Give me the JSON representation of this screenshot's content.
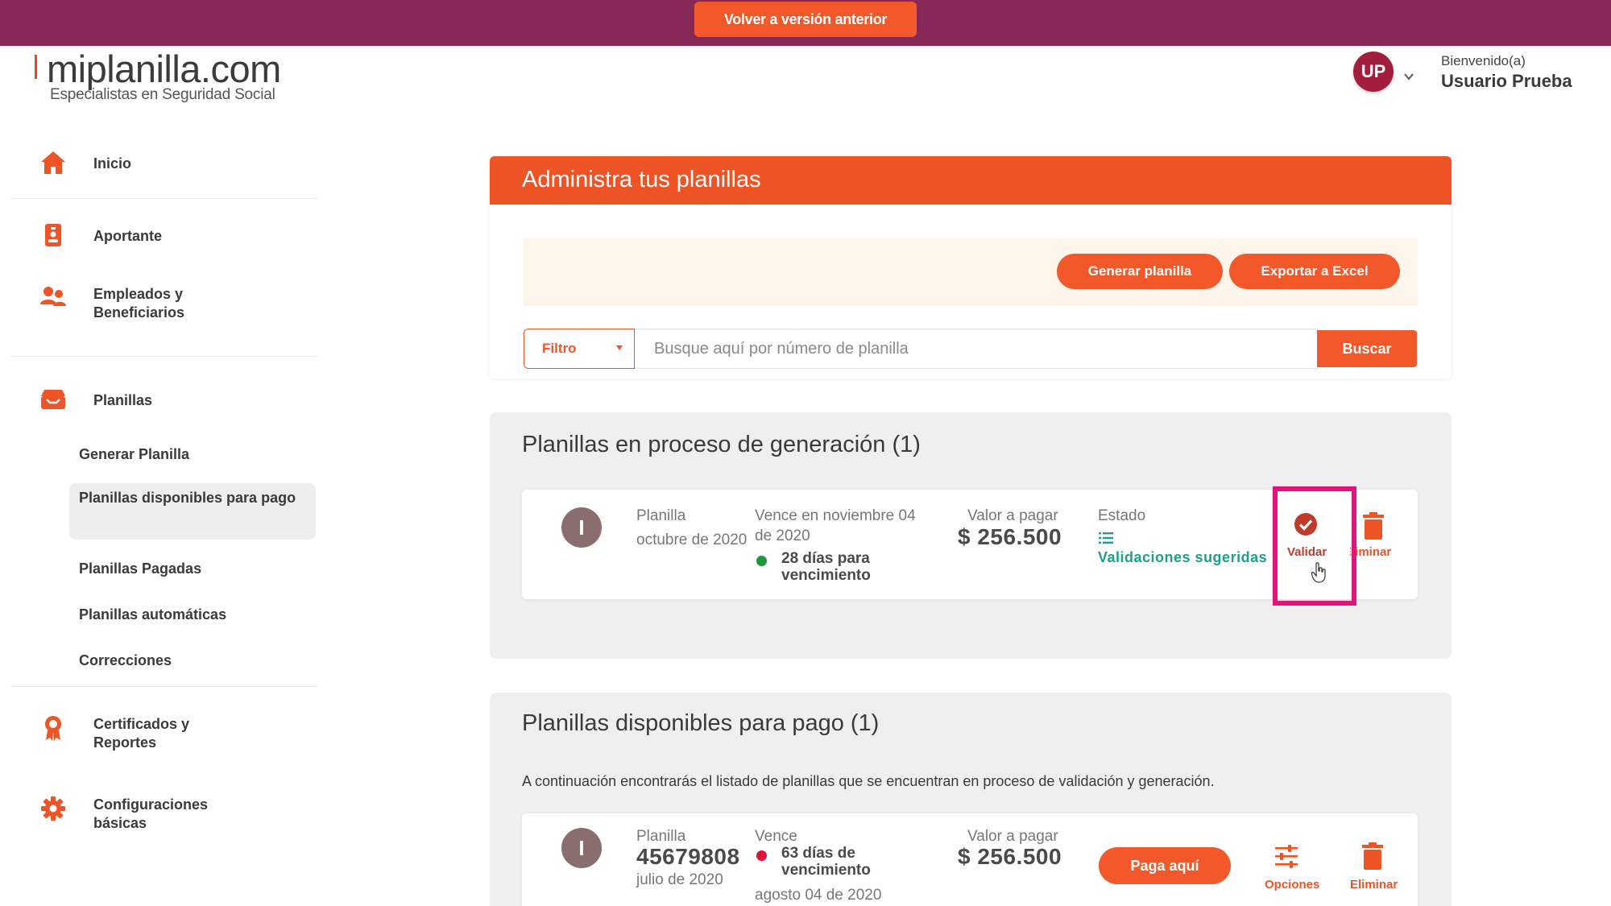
{
  "banner": {
    "back_label": "Volver a versión anterior"
  },
  "logo": {
    "name": "miplanilla.com",
    "tagline": "Especialistas en Seguridad Social"
  },
  "user": {
    "initials": "UP",
    "greeting": "Bienvenido(a)",
    "name": "Usuario Prueba"
  },
  "sidebar": {
    "items": [
      {
        "label": "Inicio",
        "icon": "home-icon"
      },
      {
        "label": "Aportante",
        "icon": "id-badge-icon"
      },
      {
        "label": "Empleados y Beneficiarios",
        "icon": "users-icon"
      },
      {
        "label": "Planillas",
        "icon": "tray-icon"
      },
      {
        "label": "Certificados y Reportes",
        "icon": "award-icon"
      },
      {
        "label": "Configuraciones básicas",
        "icon": "gear-icon"
      }
    ],
    "subitems": [
      {
        "label": "Generar Planilla"
      },
      {
        "label": "Planillas disponibles para pago",
        "active": true
      },
      {
        "label": "Planillas Pagadas"
      },
      {
        "label": "Planillas automáticas"
      },
      {
        "label": "Correcciones"
      }
    ]
  },
  "main": {
    "title": "Administra tus planillas",
    "generate_label": "Generar planilla",
    "export_label": "Exportar a Excel",
    "filter_label": "Filtro",
    "search_placeholder": "Busque aquí por número de planilla",
    "search_label": "Buscar"
  },
  "in_process": {
    "title": "Planillas en proceso de generación (1)",
    "card": {
      "icon_letter": "I",
      "planilla_label": "Planilla",
      "period": "octubre de 2020",
      "due_line1": "Vence en noviembre 04",
      "due_line2": "de 2020",
      "days_line1": "28 días para",
      "days_line2": "vencimiento",
      "value_label": "Valor a pagar",
      "value": "$ 256.500",
      "status_label": "Estado",
      "status_value": "Validaciones sugeridas",
      "validate_label": "Validar",
      "delete_label": "Eliminar"
    }
  },
  "available": {
    "title": "Planillas disponibles para pago (1)",
    "description": "A continuación encontrarás el listado de planillas que se encuentran en proceso de validación y generación.",
    "card": {
      "icon_letter": "I",
      "planilla_label": "Planilla",
      "number": "45679808",
      "period": "julio de 2020",
      "due_label": "Vence",
      "days_line1": "63 días de",
      "days_line2": "vencimiento",
      "due_date": "agosto 04 de 2020",
      "value_label": "Valor a pagar",
      "value": "$ 256.500",
      "pay_label": "Paga aquí",
      "options_label": "Opciones",
      "delete_label": "Eliminar"
    }
  },
  "colors": {
    "banner": "#862858",
    "accent": "#f2582a",
    "status_teal": "#1f9e8a",
    "dot_green": "#1e9a3c",
    "dot_red": "#e0143c",
    "highlight": "#e0147a"
  }
}
